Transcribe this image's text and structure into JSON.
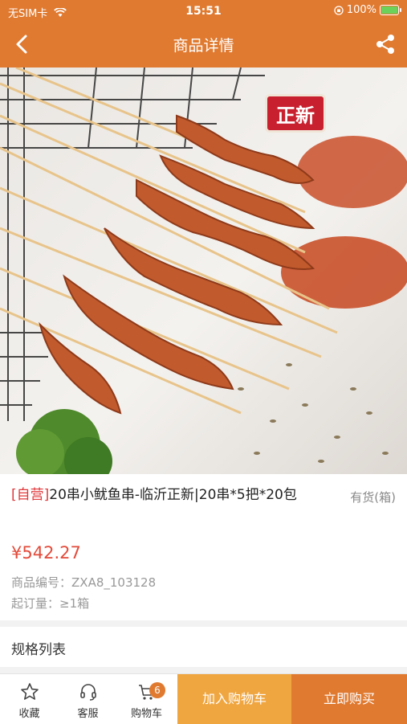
{
  "status_bar": {
    "carrier": "无SIM卡",
    "time": "15:51",
    "battery": "100%"
  },
  "nav": {
    "title": "商品详情"
  },
  "product": {
    "brand_logo": "正新",
    "tag": "[自营]",
    "title": "20串小鱿鱼串-临沂正新|20串*5把*20包",
    "stock": "有货(箱)",
    "price": "¥542.27",
    "code_label": "商品编号：",
    "code_value": "ZXA8_103128",
    "moq_label": "起订量：",
    "moq_value": "≥1箱"
  },
  "spec": {
    "label": "规格列表"
  },
  "bottom_bar": {
    "favorite_label": "收藏",
    "service_label": "客服",
    "cart_label": "购物车",
    "cart_count": "6",
    "add_to_cart": "加入购物车",
    "buy_now": "立即购买"
  },
  "colors": {
    "primary": "#e07a30",
    "secondary": "#f0a640",
    "price": "#e34a3a",
    "tag": "#e0373a"
  }
}
